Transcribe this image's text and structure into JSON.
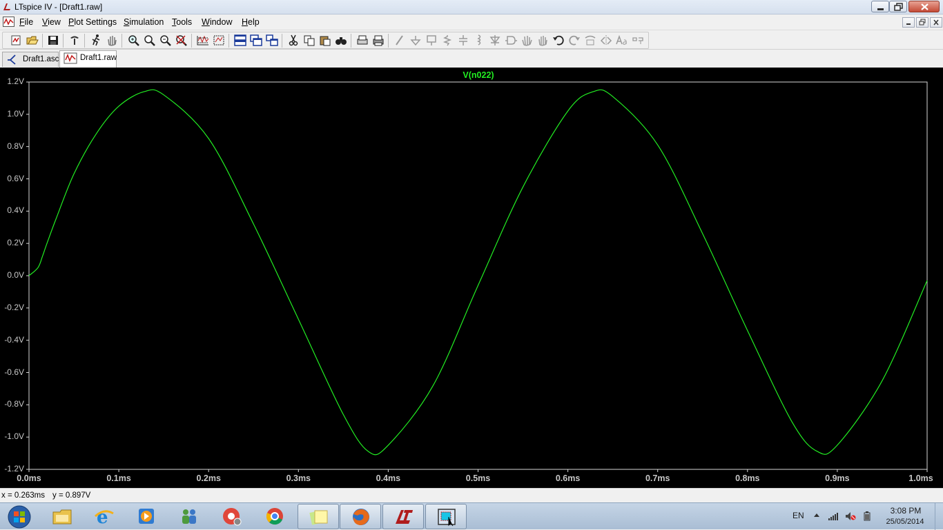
{
  "window": {
    "title": "LTspice IV - [Draft1.raw]"
  },
  "menu": [
    "File",
    "View",
    "Plot Settings",
    "Simulation",
    "Tools",
    "Window",
    "Help"
  ],
  "toolbar": {
    "icons": [
      "new-schematic-icon",
      "open-icon",
      "save-icon",
      "control-panel-icon",
      "run-icon",
      "halt-pan-icon",
      "zoom-area-icon",
      "zoom-in-icon",
      "zoom-out-icon",
      "zoom-fit-icon",
      "autorange-icon",
      "mark-data-icon",
      "tile-horizontal-icon",
      "cascade-icon",
      "tile-vertical-icon",
      "cut-icon",
      "copy-icon",
      "paste-icon",
      "find-icon",
      "print-preview-icon",
      "print-icon",
      "draw-wire-icon",
      "ground-icon",
      "label-net-icon",
      "resistor-icon",
      "capacitor-icon",
      "inductor-icon",
      "diode-icon",
      "component-icon",
      "move-icon",
      "drag-icon",
      "undo-icon",
      "redo-icon",
      "rotate-icon",
      "mirror-icon",
      "text-icon",
      "spice-directive-icon"
    ]
  },
  "tabs": [
    {
      "label": "Draft1.asc",
      "active": false
    },
    {
      "label": "Draft1.raw",
      "active": true
    }
  ],
  "plot": {
    "trace_name": "V(n022)",
    "trace_color": "#22ee22",
    "background": "#000000",
    "y_ticks": [
      "1.2V",
      "1.0V",
      "0.8V",
      "0.6V",
      "0.4V",
      "0.2V",
      "0.0V",
      "-0.2V",
      "-0.4V",
      "-0.6V",
      "-0.8V",
      "-1.0V",
      "-1.2V"
    ],
    "x_ticks": [
      "0.0ms",
      "0.1ms",
      "0.2ms",
      "0.3ms",
      "0.4ms",
      "0.5ms",
      "0.6ms",
      "0.7ms",
      "0.8ms",
      "0.9ms",
      "1.0ms"
    ]
  },
  "chart_data": {
    "type": "line",
    "title": "V(n022)",
    "xlabel": "",
    "ylabel": "",
    "xlim": [
      0,
      1.0
    ],
    "ylim": [
      -1.2,
      1.2
    ],
    "x_unit": "ms",
    "y_unit": "V",
    "series": [
      {
        "name": "V(n022)",
        "color": "#22ee22",
        "x": [
          0.0,
          0.01,
          0.015,
          0.02,
          0.03,
          0.05,
          0.075,
          0.1,
          0.128,
          0.15,
          0.2,
          0.25,
          0.3,
          0.35,
          0.378,
          0.4,
          0.45,
          0.5,
          0.55,
          0.6,
          0.628,
          0.65,
          0.7,
          0.75,
          0.8,
          0.85,
          0.878,
          0.9,
          0.95,
          1.0
        ],
        "y": [
          0.0,
          0.05,
          0.12,
          0.2,
          0.35,
          0.63,
          0.88,
          1.05,
          1.14,
          1.12,
          0.85,
          0.32,
          -0.27,
          -0.86,
          -1.09,
          -1.05,
          -0.68,
          -0.06,
          0.55,
          1.02,
          1.14,
          1.11,
          0.81,
          0.26,
          -0.34,
          -0.91,
          -1.09,
          -1.05,
          -0.65,
          -0.03
        ]
      }
    ]
  },
  "status": {
    "x_readout": "x = 0.263ms",
    "y_readout": "y = 0.897V"
  },
  "taskbar": {
    "apps": [
      "start-orb-icon",
      "explorer-icon",
      "internet-explorer-icon",
      "media-player-icon",
      "network-icon",
      "chrome-canary-icon",
      "chrome-icon",
      "sticky-notes-icon",
      "firefox-icon",
      "ltspice-icon",
      "snipping-tool-icon"
    ],
    "language": "EN",
    "time": "3:08 PM",
    "date": "25/05/2014"
  }
}
